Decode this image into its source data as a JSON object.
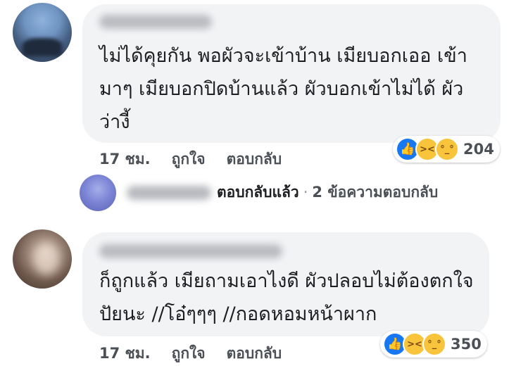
{
  "comments": [
    {
      "author": "",
      "text": "ไม่ได้คุยกัน พอผัวจะเข้าบ้าน เมียบอกเออ เข้ามาๆ เมียบอกปิดบ้านแล้ว ผัวบอกเข้าไม่ได้ ผัวว่างี้",
      "time": "17 ชม.",
      "like_label": "ถูกใจ",
      "reply_label": "ตอบกลับ",
      "reactions": [
        "like-icon",
        "haha-icon",
        "sad-icon"
      ],
      "reaction_count": "204",
      "reply_preview": {
        "author": "",
        "verb": "ตอบกลับแล้ว",
        "separator": "·",
        "count_text": "2 ข้อความตอบกลับ"
      }
    },
    {
      "author": "",
      "text": "ก็ถูกแล้ว เมียถามเอาไงดี ผัวปลอบไม่ต้องตกใจปัยนะ //โอ๋ๆๆๆ //กอดหอมหน้าผาก",
      "time": "17 ชม.",
      "like_label": "ถูกใจ",
      "reply_label": "ตอบกลับ",
      "reactions": [
        "like-icon",
        "haha-icon",
        "sad-icon"
      ],
      "reaction_count": "350"
    }
  ],
  "colors": {
    "bubble": "#f2f3f5",
    "like_blue": "#1877f2",
    "emoji_yellow": "#f7c43c",
    "meta_text": "#4b4f56"
  }
}
